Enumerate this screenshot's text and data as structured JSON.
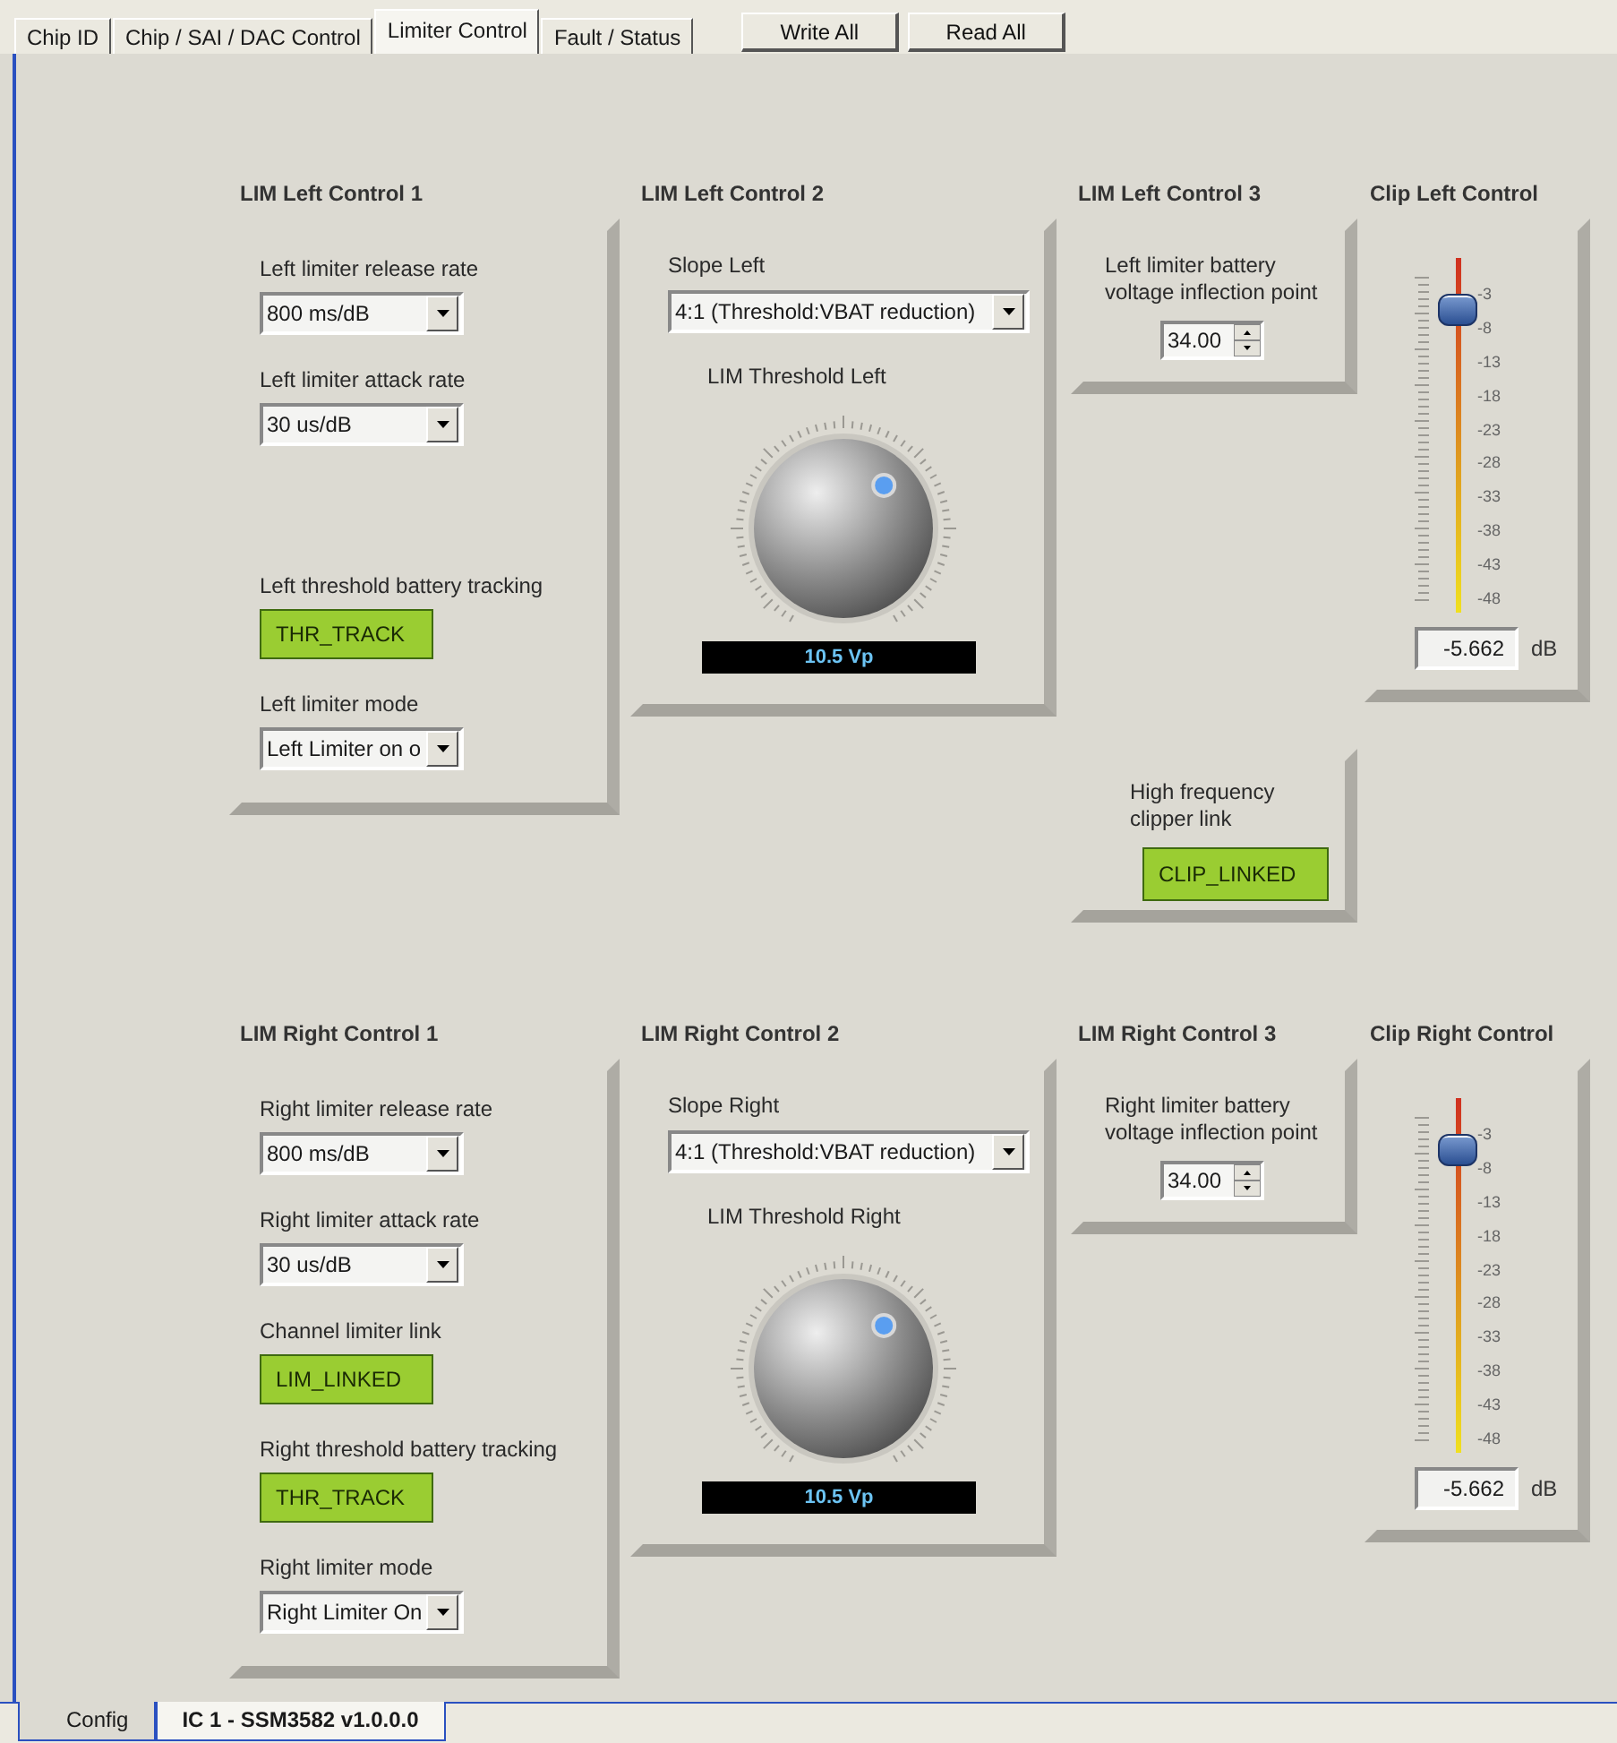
{
  "tabs": [
    {
      "label": "Chip ID",
      "selected": false
    },
    {
      "label": "Chip / SAI / DAC Control",
      "selected": false
    },
    {
      "label": "Limiter Control",
      "selected": true
    },
    {
      "label": "Fault / Status",
      "selected": false
    }
  ],
  "buttons": [
    "Write All",
    "Read All"
  ],
  "sections": [
    {
      "columns": [
        [
          {
            "kind": "controls",
            "title": "LIM Left Control 1",
            "items": [
              {
                "kind": "select",
                "label": "Left limiter release rate",
                "value": "800 ms/dB"
              },
              {
                "kind": "select",
                "label": "Left limiter attack rate",
                "value": "30 us/dB"
              },
              {
                "kind": "indicator",
                "label": "Left threshold battery tracking",
                "value": "THR_TRACK",
                "on": true
              },
              {
                "kind": "select",
                "label": "Left limiter mode",
                "value": "Left Limiter on o"
              }
            ]
          }
        ],
        [
          {
            "kind": "knob",
            "title": "LIM Left Control 2",
            "slope_label": "Slope Left",
            "slope_value": "4:1 (Threshold:VBAT reduction)",
            "knob_label": "LIM Threshold Left",
            "reading": "10.5 Vp"
          }
        ],
        [
          {
            "kind": "spinner",
            "title": "LIM Left Control 3",
            "label": "Left limiter battery voltage inflection point",
            "value": "34.00"
          },
          {
            "kind": "link",
            "label": "High frequency clipper link",
            "value": "CLIP_LINKED",
            "on": true
          }
        ],
        [
          {
            "kind": "clip",
            "title": "Clip Left Control",
            "scale": [
              "-3",
              "-8",
              "-13",
              "-18",
              "-23",
              "-28",
              "-33",
              "-38",
              "-43",
              "-48"
            ],
            "level": 0.85,
            "value": "-5.662",
            "unit": "dB"
          }
        ]
      ]
    },
    {
      "columns": [
        [
          {
            "kind": "controls",
            "title": "LIM Right Control 1",
            "items": [
              {
                "kind": "select",
                "label": "Right limiter release rate",
                "value": "800 ms/dB"
              },
              {
                "kind": "select",
                "label": "Right limiter attack rate",
                "value": "30 us/dB"
              },
              {
                "kind": "indicator",
                "label": "Channel limiter link",
                "value": "LIM_LINKED",
                "on": true
              },
              {
                "kind": "indicator",
                "label": "Right threshold battery tracking",
                "value": "THR_TRACK",
                "on": true
              },
              {
                "kind": "select",
                "label": "Right limiter mode",
                "value": "Right Limiter On"
              }
            ]
          }
        ],
        [
          {
            "kind": "knob",
            "title": "LIM Right Control 2",
            "slope_label": "Slope Right",
            "slope_value": "4:1 (Threshold:VBAT reduction)",
            "knob_label": "LIM Threshold Right",
            "reading": "10.5 Vp"
          }
        ],
        [
          {
            "kind": "spinner",
            "title": "LIM Right Control 3",
            "label": "Right limiter battery voltage inflection point",
            "value": "34.00"
          }
        ],
        [
          {
            "kind": "clip",
            "title": "Clip Right Control",
            "scale": [
              "-3",
              "-8",
              "-13",
              "-18",
              "-23",
              "-28",
              "-33",
              "-38",
              "-43",
              "-48"
            ],
            "level": 0.85,
            "value": "-5.662",
            "unit": "dB"
          }
        ]
      ]
    }
  ],
  "bottom_tabs": [
    {
      "label": "Config",
      "selected": false
    },
    {
      "label": "IC 1 - SSM3582 v1.0.0.0",
      "selected": true
    }
  ]
}
